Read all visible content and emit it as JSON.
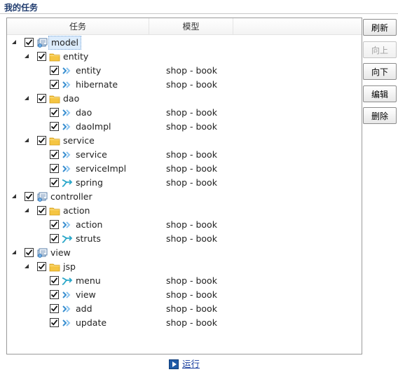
{
  "title": "我的任务",
  "columns": {
    "task": "任务",
    "model": "模型"
  },
  "buttons": {
    "refresh": "刷新",
    "up": "向上",
    "down": "向下",
    "edit": "编辑",
    "delete": "删除"
  },
  "run_label": "运行",
  "tree": [
    {
      "level": 0,
      "type": "root",
      "label": "model",
      "model": "",
      "expanded": true,
      "checked": true,
      "selected": true
    },
    {
      "level": 1,
      "type": "folder",
      "label": "entity",
      "model": "",
      "expanded": true,
      "checked": true
    },
    {
      "level": 2,
      "type": "item",
      "label": "entity",
      "model": "shop - book",
      "checked": true
    },
    {
      "level": 2,
      "type": "item",
      "label": "hibernate",
      "model": "shop - book",
      "checked": true
    },
    {
      "level": 1,
      "type": "folder",
      "label": "dao",
      "model": "",
      "expanded": true,
      "checked": true
    },
    {
      "level": 2,
      "type": "item",
      "label": "dao",
      "model": "shop - book",
      "checked": true
    },
    {
      "level": 2,
      "type": "item",
      "label": "daoImpl",
      "model": "shop - book",
      "checked": true
    },
    {
      "level": 1,
      "type": "folder",
      "label": "service",
      "model": "",
      "expanded": true,
      "checked": true
    },
    {
      "level": 2,
      "type": "item",
      "label": "service",
      "model": "shop - book",
      "checked": true
    },
    {
      "level": 2,
      "type": "item",
      "label": "serviceImpl",
      "model": "shop - book",
      "checked": true
    },
    {
      "level": 2,
      "type": "merge",
      "label": "spring",
      "model": "shop - book",
      "checked": true
    },
    {
      "level": 0,
      "type": "root",
      "label": "controller",
      "model": "",
      "expanded": true,
      "checked": true
    },
    {
      "level": 1,
      "type": "folder",
      "label": "action",
      "model": "",
      "expanded": true,
      "checked": true
    },
    {
      "level": 2,
      "type": "item",
      "label": "action",
      "model": "shop - book",
      "checked": true
    },
    {
      "level": 2,
      "type": "merge",
      "label": "struts",
      "model": "shop - book",
      "checked": true
    },
    {
      "level": 0,
      "type": "root",
      "label": "view",
      "model": "",
      "expanded": true,
      "checked": true
    },
    {
      "level": 1,
      "type": "folder",
      "label": "jsp",
      "model": "",
      "expanded": true,
      "checked": true
    },
    {
      "level": 2,
      "type": "merge",
      "label": "menu",
      "model": "shop - book",
      "checked": true
    },
    {
      "level": 2,
      "type": "item",
      "label": "view",
      "model": "shop - book",
      "checked": true
    },
    {
      "level": 2,
      "type": "item",
      "label": "add",
      "model": "shop - book",
      "checked": true
    },
    {
      "level": 2,
      "type": "item",
      "label": "update",
      "model": "shop - book",
      "checked": true
    }
  ],
  "colors": {
    "title": "#1f3b6e",
    "folder": "#f5c542",
    "item_icon": "#3a8fd0",
    "merge_icon": "#2aa7c9",
    "link": "#1a3fa0"
  }
}
